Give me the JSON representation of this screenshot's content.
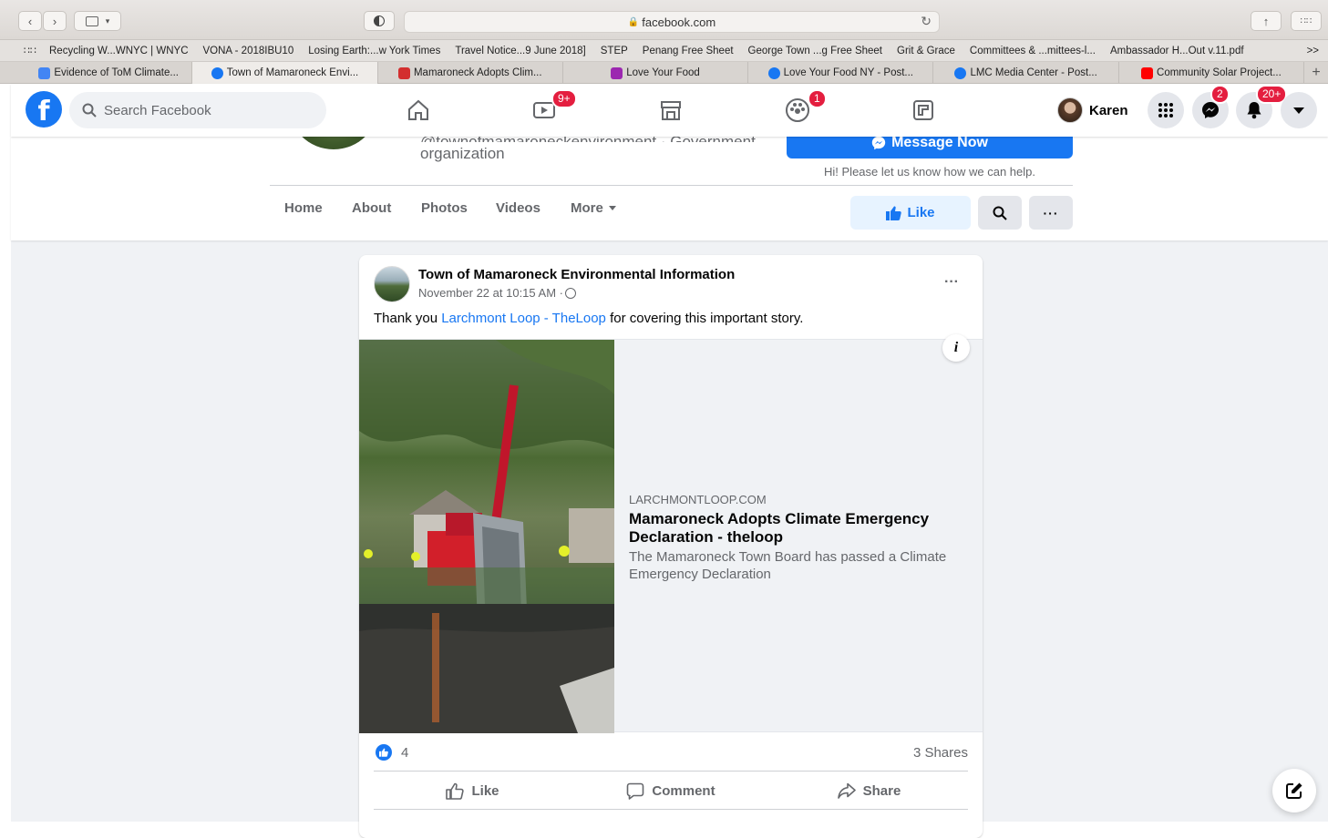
{
  "browser": {
    "url": "facebook.com",
    "bookmarks": [
      "Recycling W...WNYC | WNYC",
      "VONA - 2018IBU10",
      "Losing Earth:...w York Times",
      "Travel Notice...9 June 2018]",
      "STEP",
      "Penang Free Sheet",
      "George Town ...g Free Sheet",
      "Grit & Grace",
      "Committees & ...mittees-l...",
      "Ambassador H...Out v.11.pdf"
    ],
    "bookmarks_more": ">>",
    "tabs": [
      {
        "label": "Evidence of ToM Climate...",
        "icon": "google-docs-icon",
        "color": "#4285f4"
      },
      {
        "label": "Town of Mamaroneck Envi...",
        "icon": "facebook-icon",
        "color": "#1877f2"
      },
      {
        "label": "Mamaroneck Adopts Clim...",
        "icon": "theloop-icon",
        "color": "#d32f2f"
      },
      {
        "label": "Love Your Food",
        "icon": "love-your-food-icon",
        "color": "#9c27b0"
      },
      {
        "label": "Love Your Food NY - Post...",
        "icon": "facebook-icon",
        "color": "#1877f2"
      },
      {
        "label": "LMC Media Center - Post...",
        "icon": "facebook-icon",
        "color": "#1877f2"
      },
      {
        "label": "Community Solar Project...",
        "icon": "youtube-icon",
        "color": "#ff0000"
      }
    ],
    "new_tab": "+"
  },
  "header": {
    "search_placeholder": "Search Facebook",
    "watch_badge": "9+",
    "groups_badge": "1",
    "user_name": "Karen",
    "messenger_badge": "2",
    "notifications_badge": "20+"
  },
  "page_header": {
    "handle": "@townofmamaroneckenvironment · Government",
    "category": "organization",
    "message_button": "Message Now",
    "help_text": "Hi! Please let us know how we can help.",
    "tabs": [
      "Home",
      "About",
      "Photos",
      "Videos",
      "More"
    ],
    "like_button": "Like"
  },
  "post": {
    "author": "Town of Mamaroneck Environmental Information",
    "timestamp": "November 22 at 10:15 AM · ",
    "text_before": "Thank you ",
    "mention": "Larchmont Loop - TheLoop",
    "text_after": " for covering this important story.",
    "link": {
      "domain": "LARCHMONTLOOP.COM",
      "title": "Mamaroneck Adopts Climate Emergency Declaration - theloop",
      "description": "The Mamaroneck Town Board has passed a Climate Emergency Declaration"
    },
    "reaction_count": "4",
    "shares": "3 Shares",
    "actions": {
      "like": "Like",
      "comment": "Comment",
      "share": "Share"
    }
  }
}
